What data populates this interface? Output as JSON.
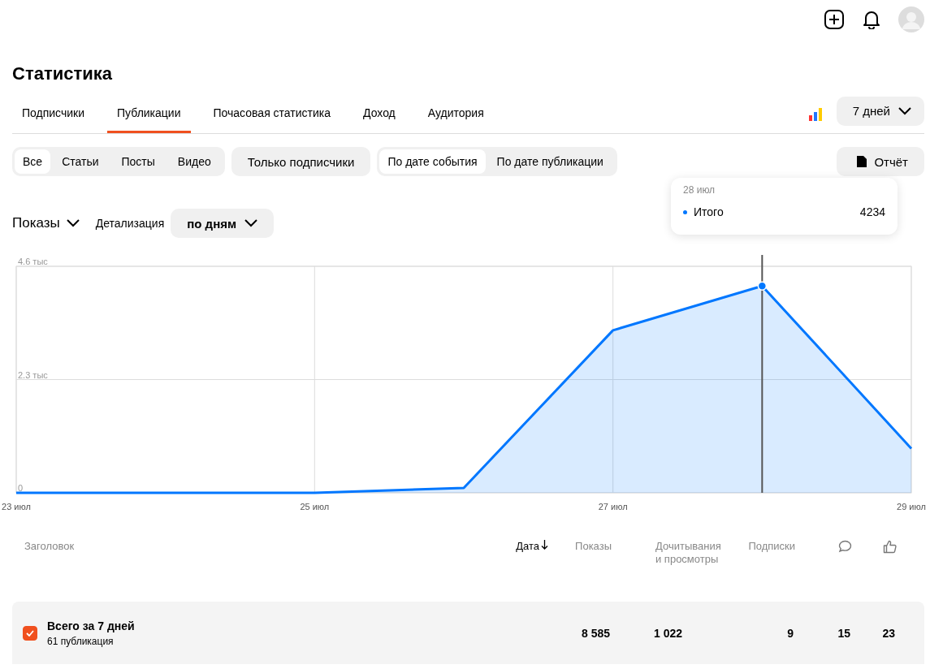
{
  "header": {
    "title": "Статистика"
  },
  "tabs": [
    {
      "label": "Подписчики",
      "selected": false
    },
    {
      "label": "Публикации",
      "selected": true
    },
    {
      "label": "Почасовая статистика",
      "selected": false
    },
    {
      "label": "Доход",
      "selected": false
    },
    {
      "label": "Аудитория",
      "selected": false
    }
  ],
  "period": {
    "value": "7 дней"
  },
  "content_types": [
    {
      "label": "Все",
      "selected": true
    },
    {
      "label": "Статьи",
      "selected": false
    },
    {
      "label": "Посты",
      "selected": false
    },
    {
      "label": "Видео",
      "selected": false
    }
  ],
  "subscribers_only": {
    "label": "Только подписчики",
    "selected": false
  },
  "date_modes": [
    {
      "label": "По дате события",
      "selected": true
    },
    {
      "label": "По дате публикации",
      "selected": false
    }
  ],
  "report_button": "Отчёт",
  "metric": {
    "value": "Показы"
  },
  "detail": {
    "label": "Детализация",
    "value": "по дням"
  },
  "tooltip": {
    "date": "28 июл",
    "value": "4234"
  },
  "chart": {
    "chart_data": {
      "type": "area",
      "x": [
        23,
        24,
        25,
        26,
        27,
        28,
        29
      ],
      "xlim": [
        23,
        29
      ],
      "xticks": [
        {
          "value": 23,
          "label": "23 июл"
        },
        {
          "value": 25,
          "label": "25 июл"
        },
        {
          "value": 27,
          "label": "27 июл"
        },
        {
          "value": 29,
          "label": "29 июл"
        }
      ],
      "ylim": [
        0,
        4.6
      ],
      "grid": true,
      "ref_lines": [
        {
          "axis": "x",
          "value": 28
        }
      ],
      "yticks": [
        {
          "value": 0,
          "label": "0"
        },
        {
          "value": 2.3,
          "label": "2.3 тыс"
        },
        {
          "value": 4.6,
          "label": "4.6 тыс"
        }
      ],
      "series": [
        {
          "name": "Итого",
          "color": "#0077ff",
          "values": [
            0,
            0,
            0,
            0.1,
            3.3,
            4.2,
            0.9
          ]
        }
      ]
    }
  },
  "table": {
    "columns": [
      {
        "kind": "text",
        "label": "Заголовок",
        "sorted": false
      },
      {
        "kind": "text",
        "label": "Дата",
        "sorted": true
      },
      {
        "kind": "text",
        "label": "Показы",
        "sorted": false
      },
      {
        "kind": "text",
        "label": "Дочитывания и просмотры",
        "sorted": false
      },
      {
        "kind": "text",
        "label": "Подписки",
        "sorted": false
      },
      {
        "kind": "comment",
        "sorted": false
      },
      {
        "kind": "like",
        "sorted": false
      }
    ],
    "total": {
      "checked": true,
      "title": "Всего за 7 дней",
      "subtitle": "61 публикация",
      "values": [
        "8 585",
        "1 022",
        "9",
        "15",
        "23"
      ]
    }
  }
}
